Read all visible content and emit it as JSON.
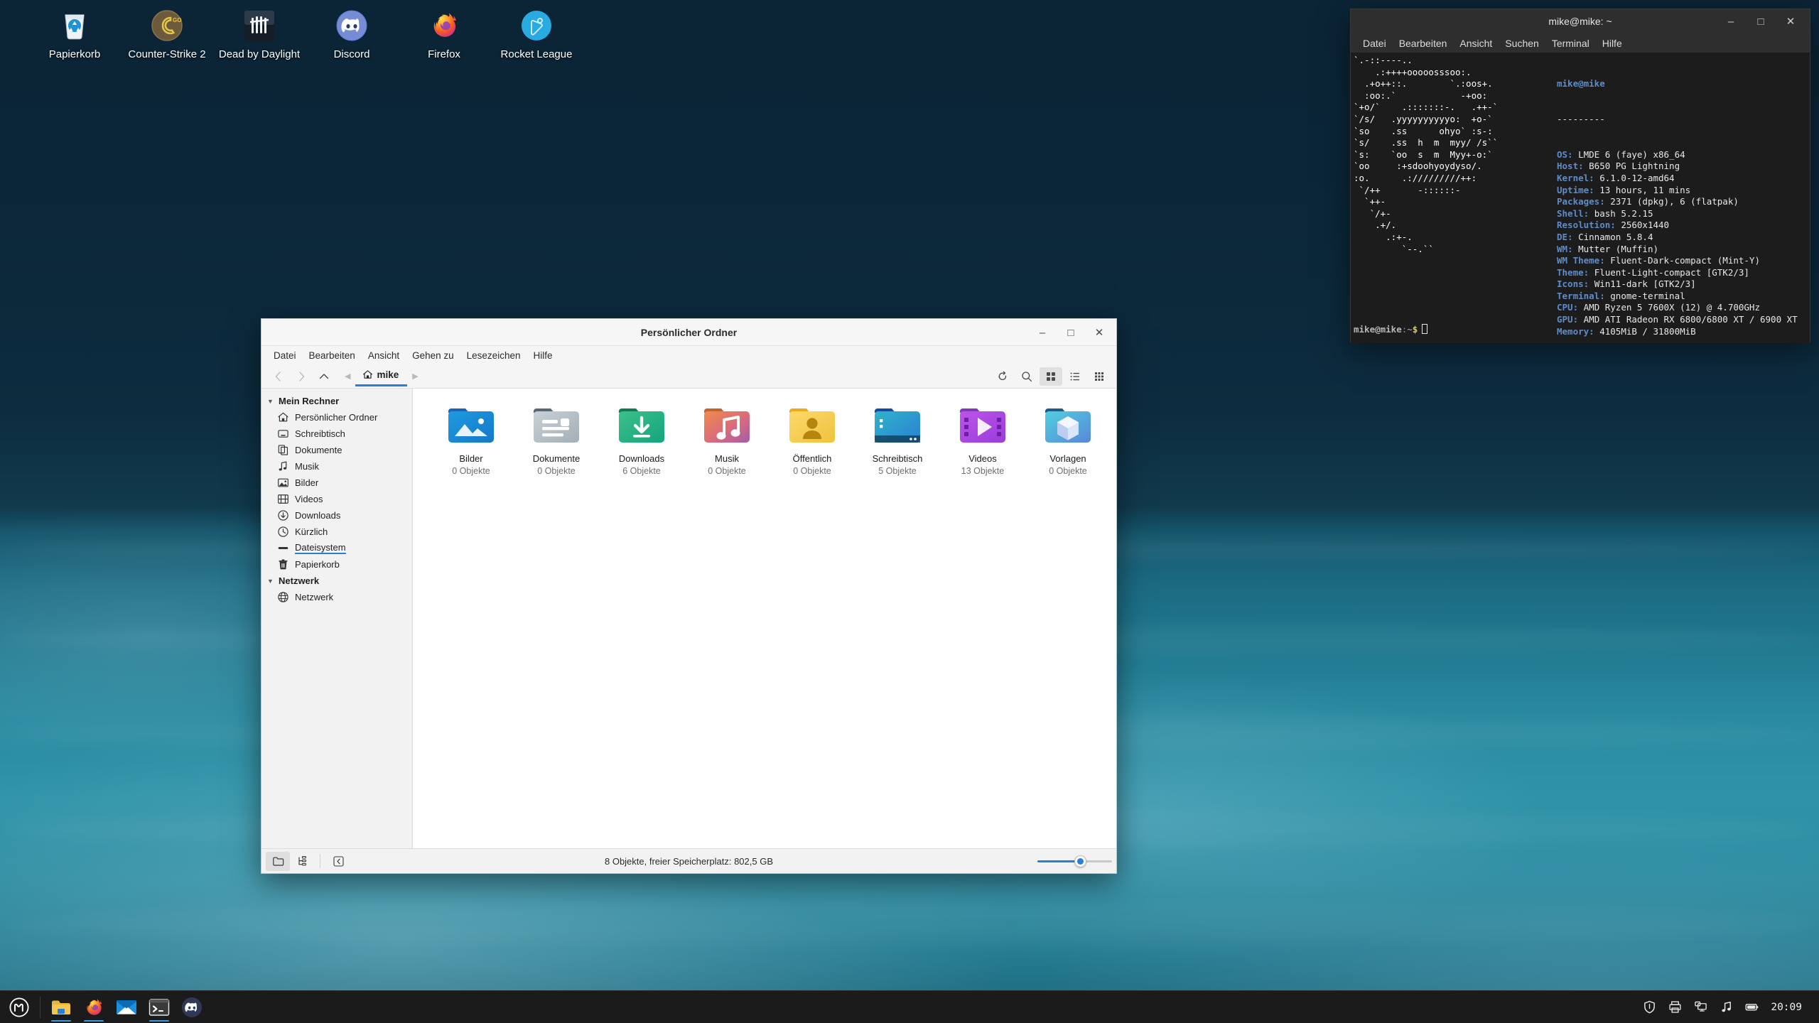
{
  "desktop": {
    "icons": [
      {
        "label": "Papierkorb",
        "icon": "trash-icon"
      },
      {
        "label": "Counter-Strike 2",
        "icon": "counter-strike-icon"
      },
      {
        "label": "Dead by Daylight",
        "icon": "dead-by-daylight-icon"
      },
      {
        "label": "Discord",
        "icon": "discord-icon"
      },
      {
        "label": "Firefox",
        "icon": "firefox-icon"
      },
      {
        "label": "Rocket League",
        "icon": "rocket-league-icon"
      }
    ]
  },
  "terminal": {
    "title": "mike@mike: ~",
    "menu": [
      "Datei",
      "Bearbeiten",
      "Ansicht",
      "Suchen",
      "Terminal",
      "Hilfe"
    ],
    "controls": {
      "minimize": "–",
      "maximize": "□",
      "close": "✕"
    },
    "ascii": "`.-::----..\n    .:++++ooooosssoo:.\n  .+o++::.        `.:oos+.\n  :oo:.`            -+oo:\n`+o/`    .:::::::-.   .++-`\n`/s/   .yyyyyyyyyyo:  +o-`\n`so    .ss      ohyo` :s-:\n`s/    .ss  h  m  myy/ /s``\n`s:    `oo  s  m  Myy+-o:`\n`oo     :+sdoohyoydyso/.\n:o.      .://///////++:\n `/++       -::::::-\n  `++-\n   `/+-\n    .+/.\n      .:+-.\n         `--.``",
    "fetch": {
      "user": "mike@mike",
      "rule": "---------",
      "rows": [
        {
          "key": "OS",
          "value": "LMDE 6 (faye) x86_64"
        },
        {
          "key": "Host",
          "value": "B650 PG Lightning"
        },
        {
          "key": "Kernel",
          "value": "6.1.0-12-amd64"
        },
        {
          "key": "Uptime",
          "value": "13 hours, 11 mins"
        },
        {
          "key": "Packages",
          "value": "2371 (dpkg), 6 (flatpak)"
        },
        {
          "key": "Shell",
          "value": "bash 5.2.15"
        },
        {
          "key": "Resolution",
          "value": "2560x1440"
        },
        {
          "key": "DE",
          "value": "Cinnamon 5.8.4"
        },
        {
          "key": "WM",
          "value": "Mutter (Muffin)"
        },
        {
          "key": "WM Theme",
          "value": "Fluent-Dark-compact (Mint-Y)"
        },
        {
          "key": "Theme",
          "value": "Fluent-Light-compact [GTK2/3]"
        },
        {
          "key": "Icons",
          "value": "Win11-dark [GTK2/3]"
        },
        {
          "key": "Terminal",
          "value": "gnome-terminal"
        },
        {
          "key": "CPU",
          "value": "AMD Ryzen 5 7600X (12) @ 4.700GHz"
        },
        {
          "key": "GPU",
          "value": "AMD ATI Radeon RX 6800/6800 XT / 6900 XT"
        },
        {
          "key": "Memory",
          "value": "4105MiB / 31800MiB"
        }
      ],
      "palette_row1": [
        "#3b3b3b",
        "#d80000",
        "#82b2e0",
        "#d3a30a",
        "#3c78b4",
        "#7a5a8e",
        "#13a0a8",
        "#dcdcdc"
      ],
      "palette_row2": [
        "#5e5e5e",
        "#f43030",
        "#7ddd46",
        "#fbe15a",
        "#7fb2e5",
        "#c084bf",
        "#33dde6",
        "#f2f2f2"
      ]
    },
    "prompt": {
      "user": "mike@mike",
      "colon": ":",
      "path": "~",
      "dollar": "$"
    }
  },
  "filemanager": {
    "title": "Persönlicher Ordner",
    "controls": {
      "minimize": "–",
      "maximize": "□",
      "close": "✕"
    },
    "menu": [
      "Datei",
      "Bearbeiten",
      "Ansicht",
      "Gehen zu",
      "Lesezeichen",
      "Hilfe"
    ],
    "toolbar": {
      "back": "back-icon",
      "forward": "forward-icon",
      "up": "up-icon",
      "reload": "reload-icon",
      "search": "search-icon",
      "view_icon": "icon-view-icon",
      "view_list": "list-view-icon",
      "view_compact": "compact-view-icon"
    },
    "breadcrumb": {
      "prev": "◀",
      "home_label": "mike",
      "next": "▶"
    },
    "sidebar": [
      {
        "group": "Mein Rechner",
        "items": [
          {
            "label": "Persönlicher Ordner",
            "icon": "home-icon"
          },
          {
            "label": "Schreibtisch",
            "icon": "desktop-icon"
          },
          {
            "label": "Dokumente",
            "icon": "documents-icon"
          },
          {
            "label": "Musik",
            "icon": "music-icon"
          },
          {
            "label": "Bilder",
            "icon": "pictures-icon"
          },
          {
            "label": "Videos",
            "icon": "videos-icon"
          },
          {
            "label": "Downloads",
            "icon": "downloads-icon"
          },
          {
            "label": "Kürzlich",
            "icon": "recent-icon"
          },
          {
            "label": "Dateisystem",
            "icon": "filesystem-icon",
            "highlighted": true
          },
          {
            "label": "Papierkorb",
            "icon": "trash-icon"
          }
        ]
      },
      {
        "group": "Netzwerk",
        "items": [
          {
            "label": "Netzwerk",
            "icon": "network-icon"
          }
        ]
      }
    ],
    "files": [
      {
        "name": "Bilder",
        "count": "0 Objekte",
        "icon": "folder-pictures-icon"
      },
      {
        "name": "Dokumente",
        "count": "0 Objekte",
        "icon": "folder-documents-icon"
      },
      {
        "name": "Downloads",
        "count": "6 Objekte",
        "icon": "folder-downloads-icon"
      },
      {
        "name": "Musik",
        "count": "0 Objekte",
        "icon": "folder-music-icon"
      },
      {
        "name": "Öffentlich",
        "count": "0 Objekte",
        "icon": "folder-public-icon"
      },
      {
        "name": "Schreibtisch",
        "count": "5 Objekte",
        "icon": "folder-desktop-icon"
      },
      {
        "name": "Videos",
        "count": "13 Objekte",
        "icon": "folder-videos-icon"
      },
      {
        "name": "Vorlagen",
        "count": "0 Objekte",
        "icon": "folder-templates-icon"
      }
    ],
    "status": {
      "text": "8 Objekte, freier Speicherplatz: 802,5 GB",
      "places_button": "places-icon",
      "treeview_button": "treeview-icon",
      "collapse_button": "collapse-icon"
    }
  },
  "taskbar": {
    "menu_button": "mint-menu-icon",
    "launchers": [
      {
        "name": "files-launcher",
        "icon": "files-icon",
        "running": true
      },
      {
        "name": "firefox-launcher",
        "icon": "firefox-icon",
        "running": true
      },
      {
        "name": "mail-launcher",
        "icon": "mail-icon",
        "running": false
      },
      {
        "name": "terminal-launcher",
        "icon": "terminal-icon",
        "running": true
      },
      {
        "name": "discord-launcher",
        "icon": "discord-icon",
        "running": false
      }
    ],
    "tray": [
      {
        "name": "shield-icon"
      },
      {
        "name": "printer-icon"
      },
      {
        "name": "display-icon"
      },
      {
        "name": "music-icon"
      },
      {
        "name": "battery-icon"
      }
    ],
    "clock": "20:09"
  },
  "colors": {
    "accent": "#2a7fd4",
    "terminal_bg": "#1c1c1c",
    "terminal_key": "#5f8cc7",
    "taskbar_bg": "#1b1b1b"
  }
}
